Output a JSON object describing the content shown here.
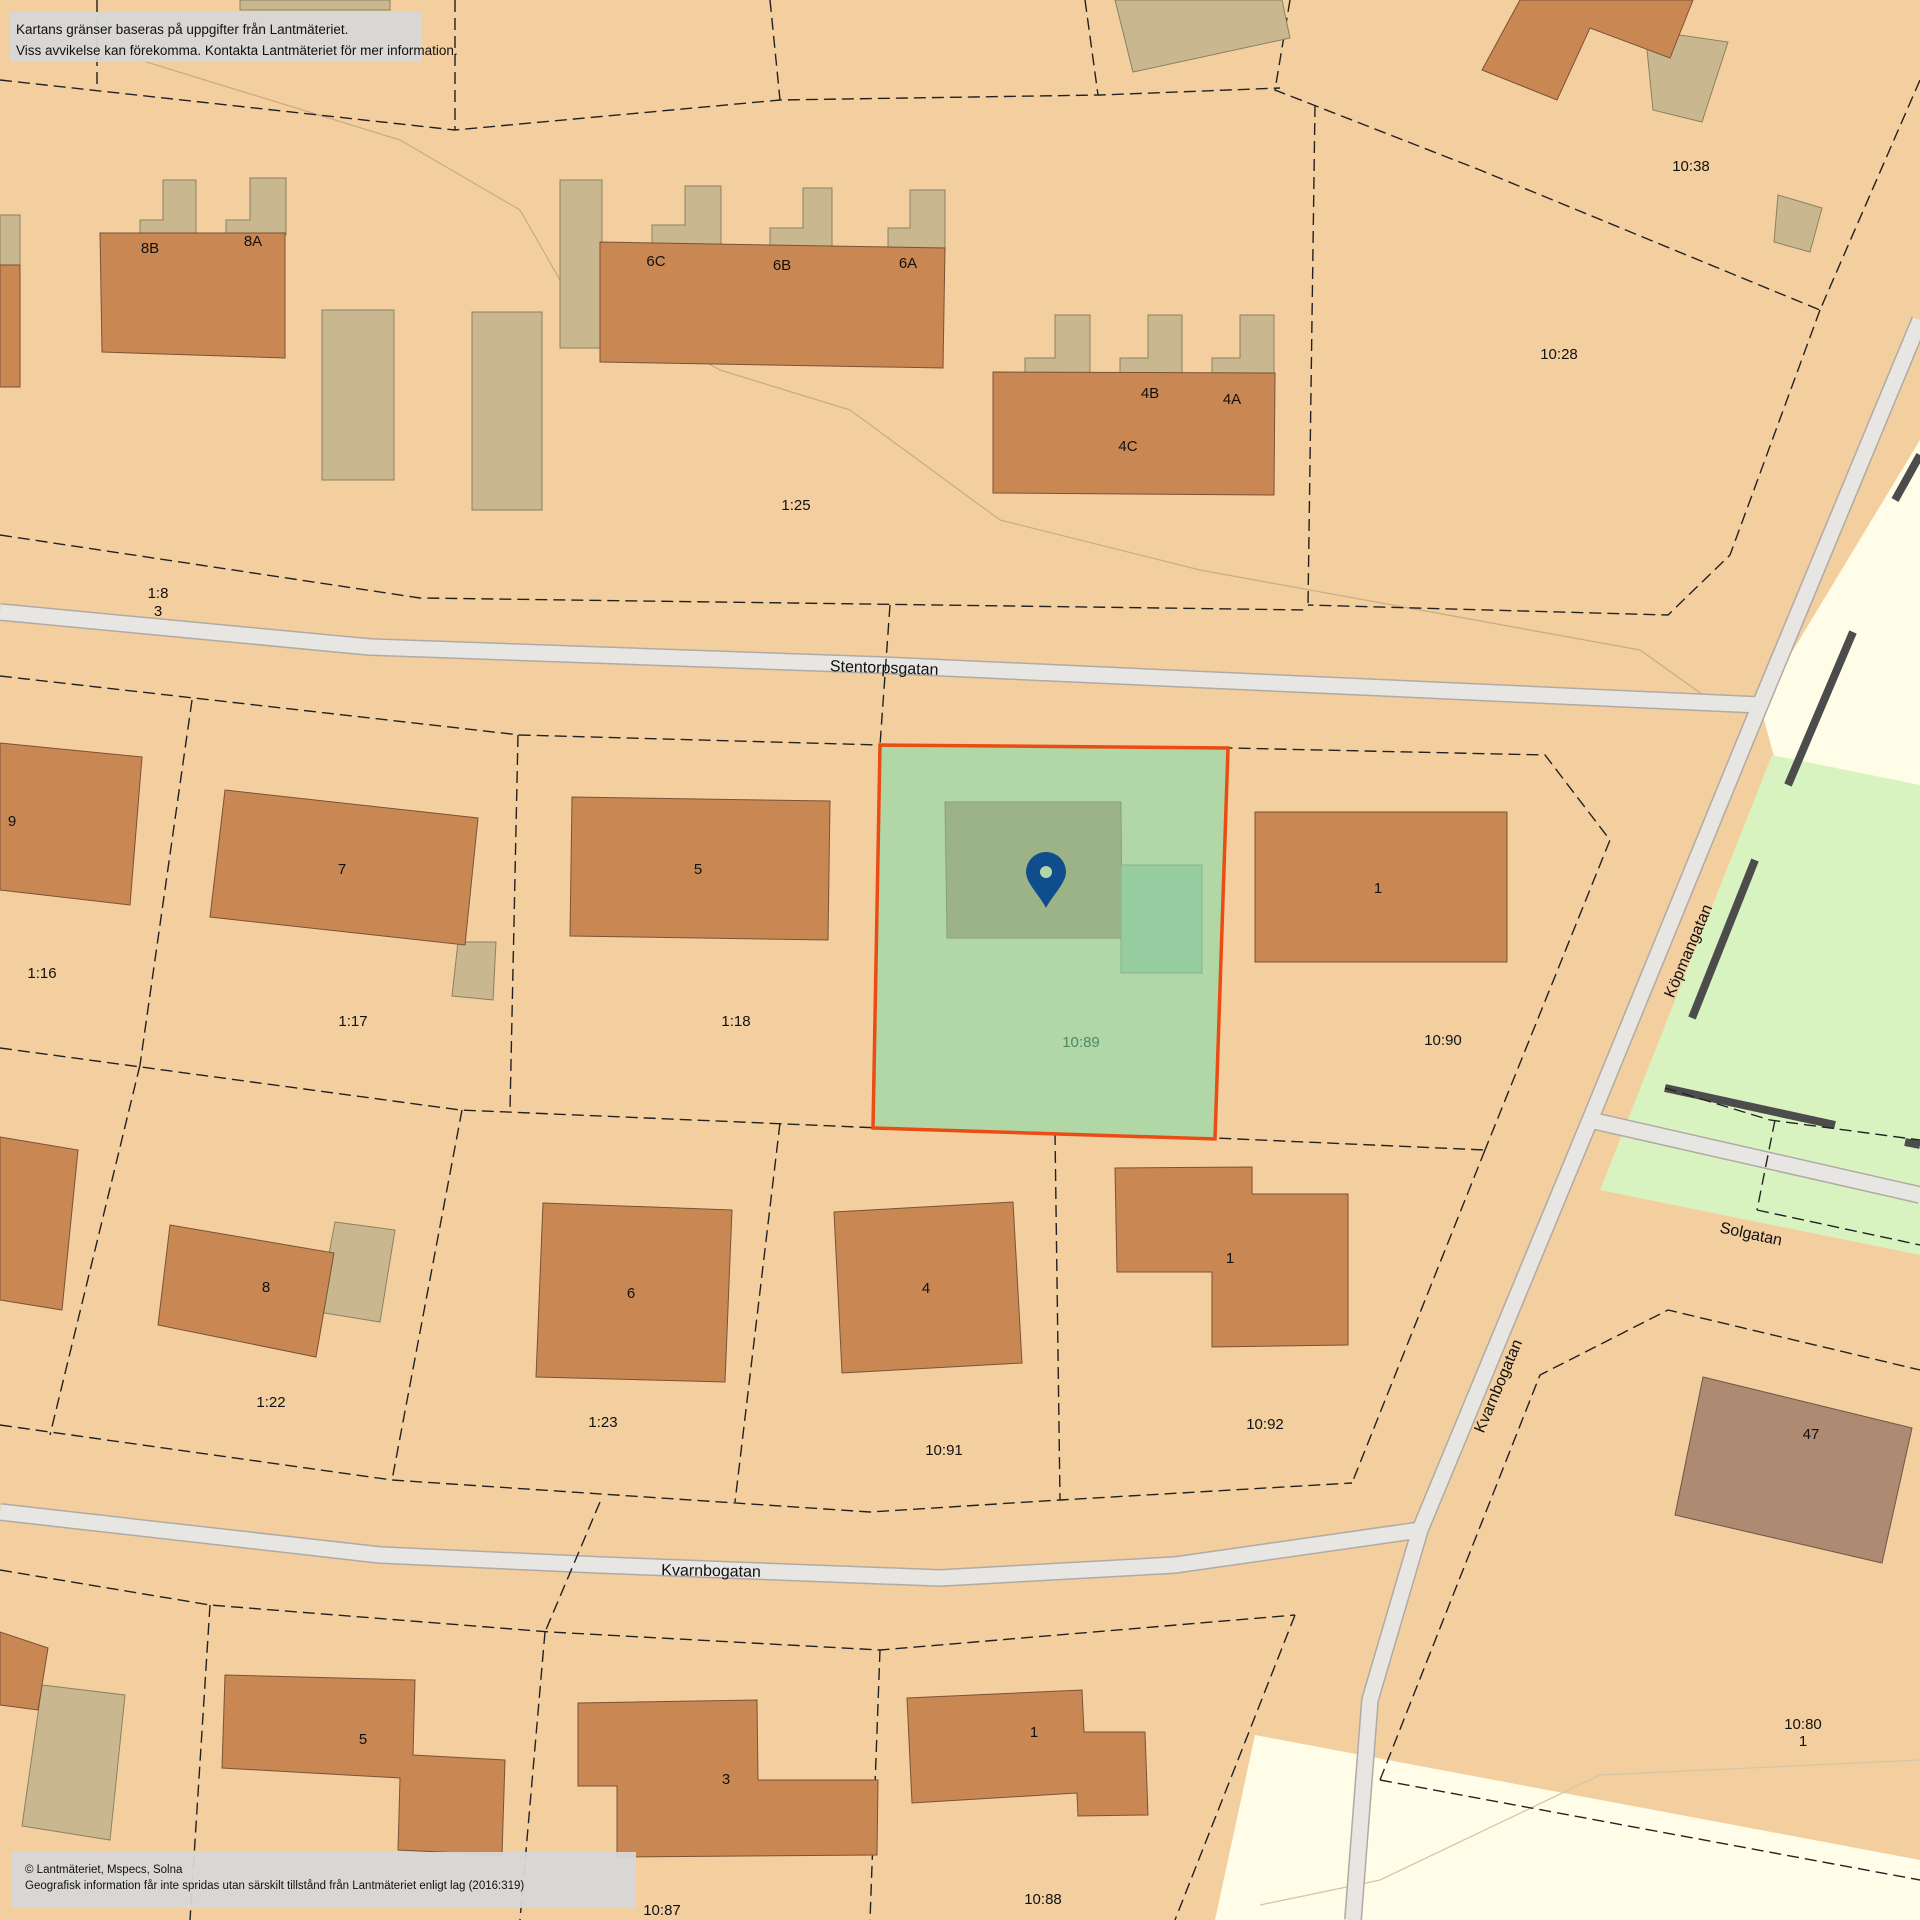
{
  "disclaimer": {
    "line1": "Kartans gränser baseras på uppgifter från Lantmäteriet.",
    "line2": "Viss avvikelse kan förekomma. Kontakta Lantmäteriet för mer information."
  },
  "copyright": {
    "line1": "© Lantmäteriet, Mspecs, Solna",
    "line2": "Geografisk information får inte spridas utan särskilt tillstånd från Lantmäteriet enligt lag (2016:319)"
  },
  "streets": {
    "stentorpsgatan": "Stentorpsgatan",
    "kvarnbogatan_h": "Kvarnbogatan",
    "kvarnbogatan_v": "Kvarnbogatan",
    "kopmangatan": "Köpmangatan",
    "solgatan": "Solgatan"
  },
  "parcels": {
    "p10_38": "10:38",
    "p10_28": "10:28",
    "p1_25": "1:25",
    "p1_8": "1:8",
    "p1_8_num": "3",
    "p1_16": "1:16",
    "p1_17": "1:17",
    "p1_18": "1:18",
    "p10_89": "10:89",
    "p10_90": "10:90",
    "p1_22": "1:22",
    "p1_23": "1:23",
    "p10_91": "10:91",
    "p10_92": "10:92",
    "p10_80": "10:80",
    "p10_80_num": "1",
    "p10_87": "10:87",
    "p10_88": "10:88"
  },
  "houses": {
    "h8B": "8B",
    "h8A": "8A",
    "h6C": "6C",
    "h6B": "6B",
    "h6A": "6A",
    "h4B": "4B",
    "h4A": "4A",
    "h4C": "4C",
    "h9": "9",
    "h7": "7",
    "h5": "5",
    "h1_right": "1",
    "h8": "8",
    "h6": "6",
    "h4": "4",
    "h1_lower": "1",
    "h47": "47",
    "h5_bottom": "5",
    "h3_bottom": "3",
    "h1_bottom": "1"
  },
  "colors": {
    "land": "#f3cf9f",
    "building": "#c98753",
    "outbuilding": "#c9b78f",
    "road": "#e8e6e3",
    "selected_fill": "#b2d7a6",
    "selected_border": "#ea4c14",
    "park": "#d9f3c0",
    "open_area": "#fffde8",
    "marker": "#0f4d8c"
  },
  "icons": {
    "location_marker": "map-pin-icon"
  }
}
